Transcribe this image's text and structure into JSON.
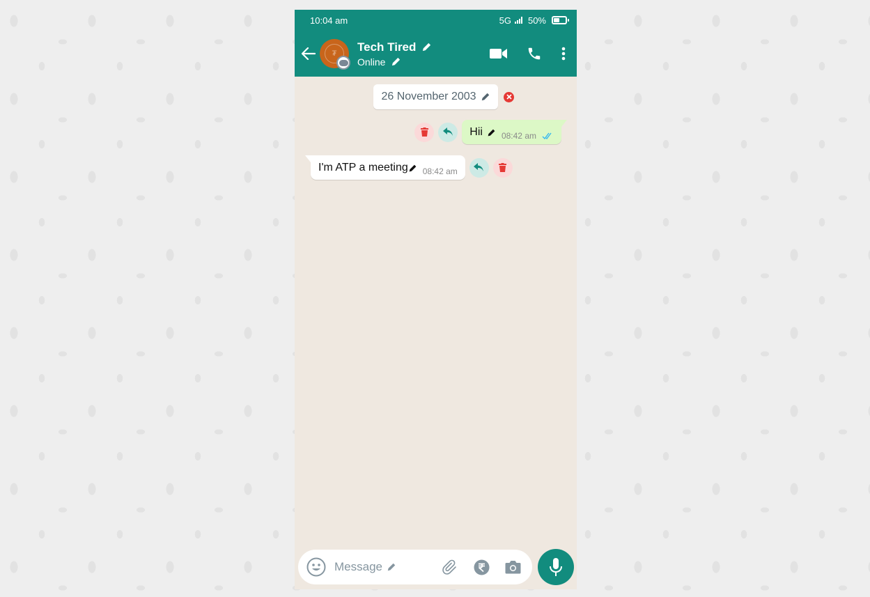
{
  "theme": {
    "primary": "#128c7e",
    "outgoing_bubble": "#dcf8c6",
    "incoming_bubble": "#ffffff",
    "delete_accent": "#e53935"
  },
  "status_bar": {
    "time": "10:04 am",
    "network": "5G",
    "battery": "50%"
  },
  "header": {
    "contact_name": "Tech Tired",
    "presence": "Online",
    "icons": [
      "back-arrow-icon",
      "video-call-icon",
      "voice-call-icon",
      "more-options-icon"
    ]
  },
  "chat": {
    "date_chip": "26 November 2003",
    "messages": [
      {
        "direction": "outgoing",
        "text": "Hii",
        "time": "08:42 am",
        "status": "read"
      },
      {
        "direction": "incoming",
        "text": "I'm ATP a meeting",
        "time": "08:42 am"
      }
    ]
  },
  "composer": {
    "placeholder": "Message",
    "icons": [
      "emoji-icon",
      "attach-icon",
      "rupee-payment-icon",
      "camera-icon",
      "microphone-icon"
    ]
  }
}
